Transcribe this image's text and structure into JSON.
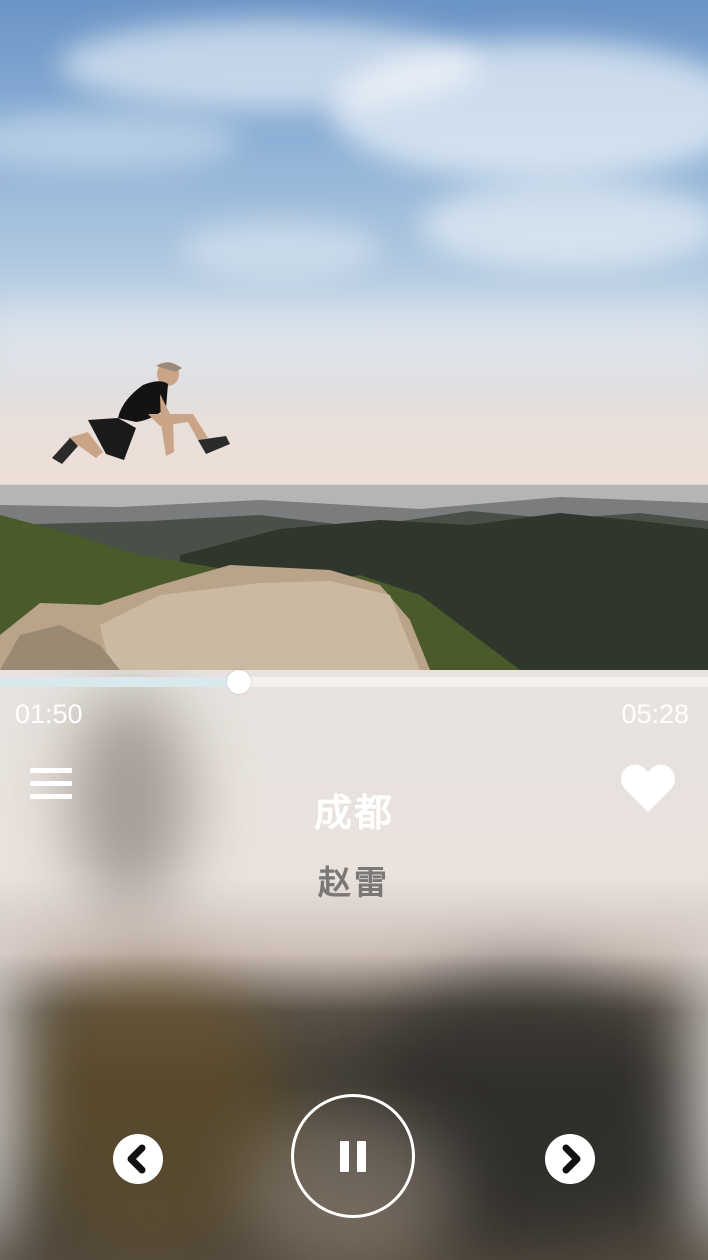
{
  "player": {
    "elapsed_time": "01:50",
    "total_time": "05:28",
    "progress": 0.337,
    "song_title": "成都",
    "artist": "赵雷",
    "is_playing": true,
    "favorited": true
  },
  "icons": {
    "menu": "menu-icon",
    "favorite": "heart-icon",
    "previous": "chevron-left-icon",
    "play_pause": "pause-icon",
    "next": "chevron-right-icon"
  },
  "colors": {
    "icon": "#ffffff",
    "artist_text": "#7a7775",
    "progress_fill": "#d6e8ec"
  }
}
